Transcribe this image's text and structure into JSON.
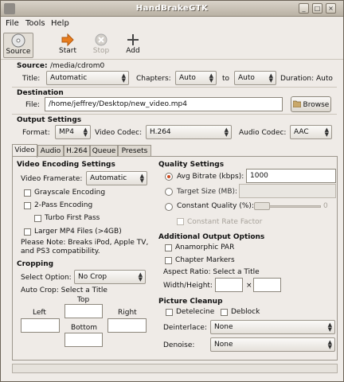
{
  "window": {
    "title": "HandBrakeGTK"
  },
  "menu": [
    "File",
    "Tools",
    "Help"
  ],
  "toolbar": {
    "source": "Source",
    "start": "Start",
    "stop": "Stop",
    "add": "Add"
  },
  "source": {
    "label": "Source:",
    "path": "/media/cdrom0",
    "title_label": "Title:",
    "title_value": "Automatic",
    "chapters_label": "Chapters:",
    "ch_from": "Auto",
    "to_label": "to",
    "ch_to": "Auto",
    "duration_label": "Duration:",
    "duration_value": "Auto"
  },
  "destination": {
    "heading": "Destination",
    "file_label": "File:",
    "file_value": "/home/jeffrey/Desktop/new_video.mp4",
    "browse": "Browse"
  },
  "output": {
    "heading": "Output Settings",
    "format_label": "Format:",
    "format_value": "MP4",
    "vcodec_label": "Video Codec:",
    "vcodec_value": "H.264",
    "acodec_label": "Audio Codec:",
    "acodec_value": "AAC"
  },
  "tabs": [
    "Video",
    "Audio",
    "H.264",
    "Queue",
    "Presets"
  ],
  "video": {
    "heading": "Video Encoding Settings",
    "framerate_label": "Video Framerate:",
    "framerate_value": "Automatic",
    "grayscale": "Grayscale Encoding",
    "twopass": "2-Pass Encoding",
    "turbo": "Turbo First Pass",
    "larger": "Larger MP4 Files (>4GB)",
    "note": "Please Note: Breaks iPod, Apple TV,",
    "note2": "and PS3 compatibility."
  },
  "cropping": {
    "heading": "Cropping",
    "select_label": "Select Option:",
    "select_value": "No Crop",
    "auto_label": "Auto Crop: Select a Title",
    "top": "Top",
    "left": "Left",
    "right": "Right",
    "bottom": "Bottom"
  },
  "quality": {
    "heading": "Quality Settings",
    "avg_label": "Avg Bitrate (kbps):",
    "avg_value": "1000",
    "target_label": "Target Size (MB):",
    "const_label": "Constant Quality (%):",
    "const_value": "0",
    "crf_label": "Constant Rate Factor",
    "selected": "avg"
  },
  "additional": {
    "heading": "Additional Output Options",
    "anamorphic": "Anamorphic PAR",
    "chapter_markers": "Chapter Markers",
    "aspect_label": "Aspect Ratio: Select a Title",
    "wh_label": "Width/Height:",
    "x": "×"
  },
  "cleanup": {
    "heading": "Picture Cleanup",
    "detelecine": "Detelecine",
    "deblock": "Deblock",
    "deinterlace_label": "Deinterlace:",
    "deinterlace_value": "None",
    "denoise_label": "Denoise:",
    "denoise_value": "None"
  },
  "colors": {
    "accent": "#cc4a1e",
    "start_arrow": "#e87d1e"
  },
  "icons": {
    "source": "disc-icon",
    "start": "play-arrow-icon",
    "stop": "stop-icon",
    "add": "plus-icon",
    "browse": "folder-icon"
  }
}
